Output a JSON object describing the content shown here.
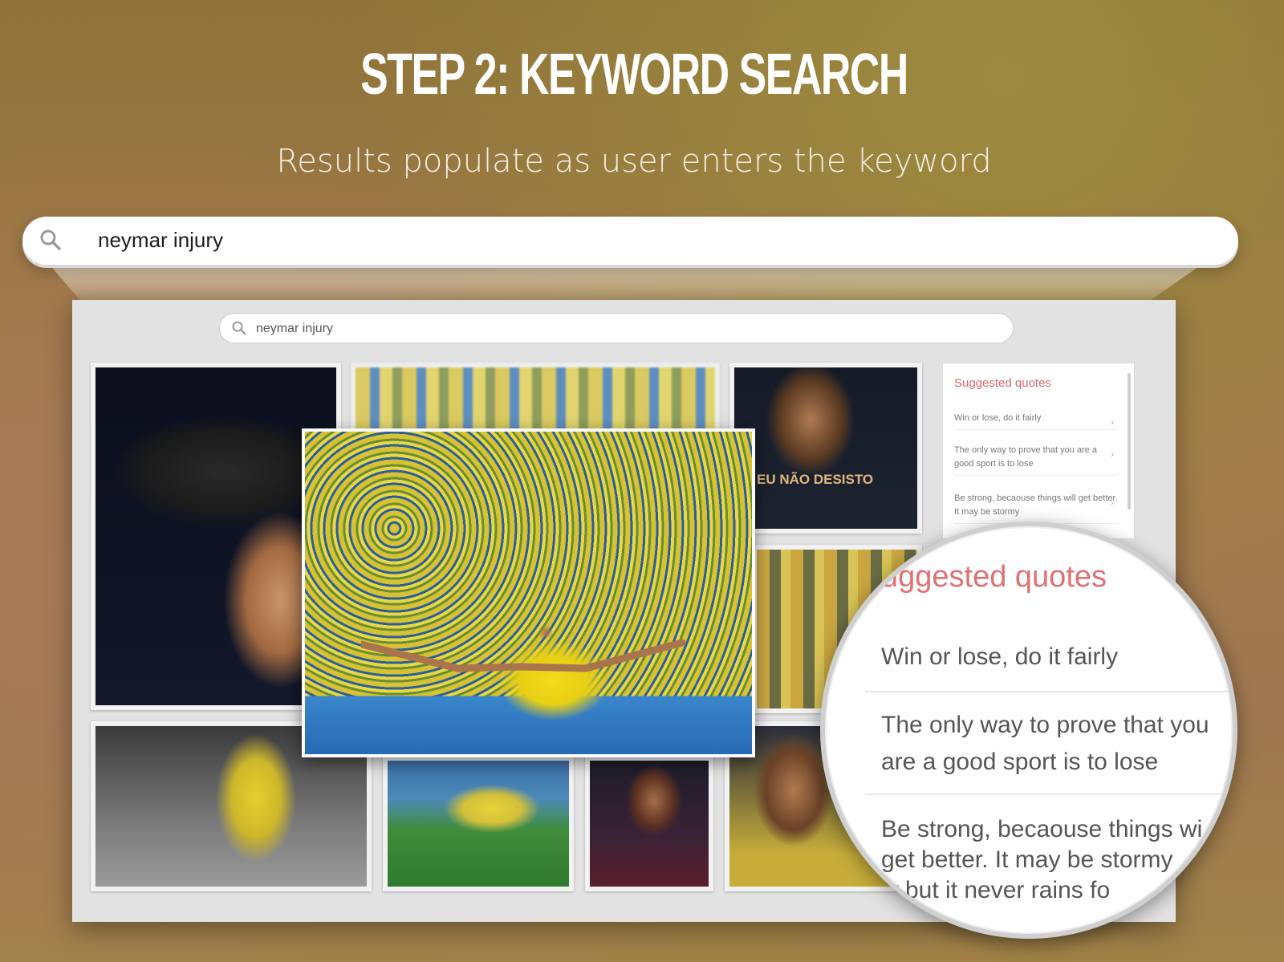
{
  "header": {
    "title": "STEP 2: KEYWORD SEARCH",
    "subtitle": "Results populate as user enters the keyword"
  },
  "search": {
    "query": "neymar injury"
  },
  "mock": {
    "search_query": "neymar injury",
    "photo_caption": "EU NÃO DESISTO",
    "suggested_quotes": {
      "heading": "Suggested quotes",
      "items": [
        "Win or lose, do it fairly",
        "The only way to prove that you are a good sport is to lose",
        "Be strong, becaouse things will get better. It may be stormy"
      ]
    }
  },
  "magnifier": {
    "heading": "uggested quotes",
    "line1": "Win or lose, do it fairly",
    "line2a": "The only way to prove that you",
    "line2b": "are a good sport is to lose",
    "line3a": "Be strong, becaouse things wi",
    "line3b": "get better. It may be stormy",
    "line3c": "w but it never rains fo"
  },
  "colors": {
    "accent": "#e07172",
    "title": "#ffffff"
  },
  "icons": [
    "search-icon",
    "chevron-right-icon"
  ]
}
